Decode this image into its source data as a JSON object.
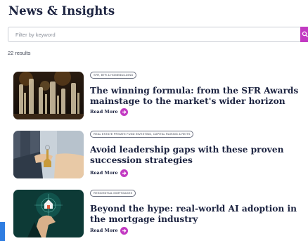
{
  "header": {
    "title": "News & Insights"
  },
  "search": {
    "placeholder": "Filter by keyword",
    "value": "",
    "icon": "search-icon"
  },
  "results": {
    "count_label": "22 results"
  },
  "articles": [
    {
      "tag": "SFR, BTR & HOMEBUILDING",
      "title": "The winning formula: from the SFR Awards mainstage to the market's wider horizon",
      "read_more": "Read More",
      "image": "awards-trophies-photo"
    },
    {
      "tag": "REAL ESTATE PRIVATE FUND INVESTING, CAPITAL RAISING & REITS",
      "title": "Avoid leadership gaps with these proven succession strategies",
      "read_more": "Read More",
      "image": "house-key-handover-photo"
    },
    {
      "tag": "RESIDENTIAL MORTGAGES",
      "title": "Beyond the hype: real-world AI adoption in the mortgage industry",
      "read_more": "Read More",
      "image": "digital-house-hand-photo"
    }
  ],
  "colors": {
    "accent": "#c23ac2",
    "heading": "#1c2340",
    "side_tab": "#2f7de1"
  }
}
